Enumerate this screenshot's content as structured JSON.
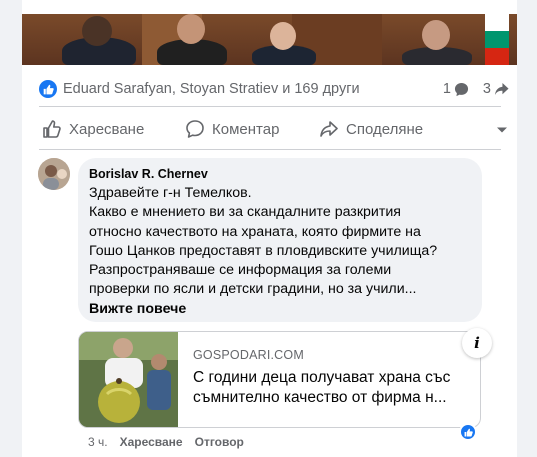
{
  "post": {
    "reactions": {
      "names_text": "Eduard Sarafyan, Stoyan Stratiev и 169 други",
      "comments_count": "1",
      "shares_count": "3"
    },
    "actions": {
      "like_label": "Харесване",
      "comment_label": "Коментар",
      "share_label": "Споделяне"
    }
  },
  "comment": {
    "author": "Borislav R. Chernev",
    "text": "Здравейте г-н Темелков.\nКакво е мнението ви за скандалните разкрития\nотносно качеството на храната, която фирмите на\nГошо Цанков предоставят в пловдивските училища?\nРазпространяваше се информация за големи\nпроверки по ясли и детски градини, но за учили...",
    "see_more": "Вижте повече",
    "link_preview": {
      "domain": "GOSPODARI.COM",
      "title": "С години деца получават храна със съмнително качество от фирма н..."
    },
    "time": "3 ч.",
    "like_label": "Харесване",
    "reply_label": "Отговор"
  },
  "colors": {
    "accent": "#1877f2",
    "secondary_text": "#65676b",
    "bubble_bg": "#f0f2f5"
  }
}
